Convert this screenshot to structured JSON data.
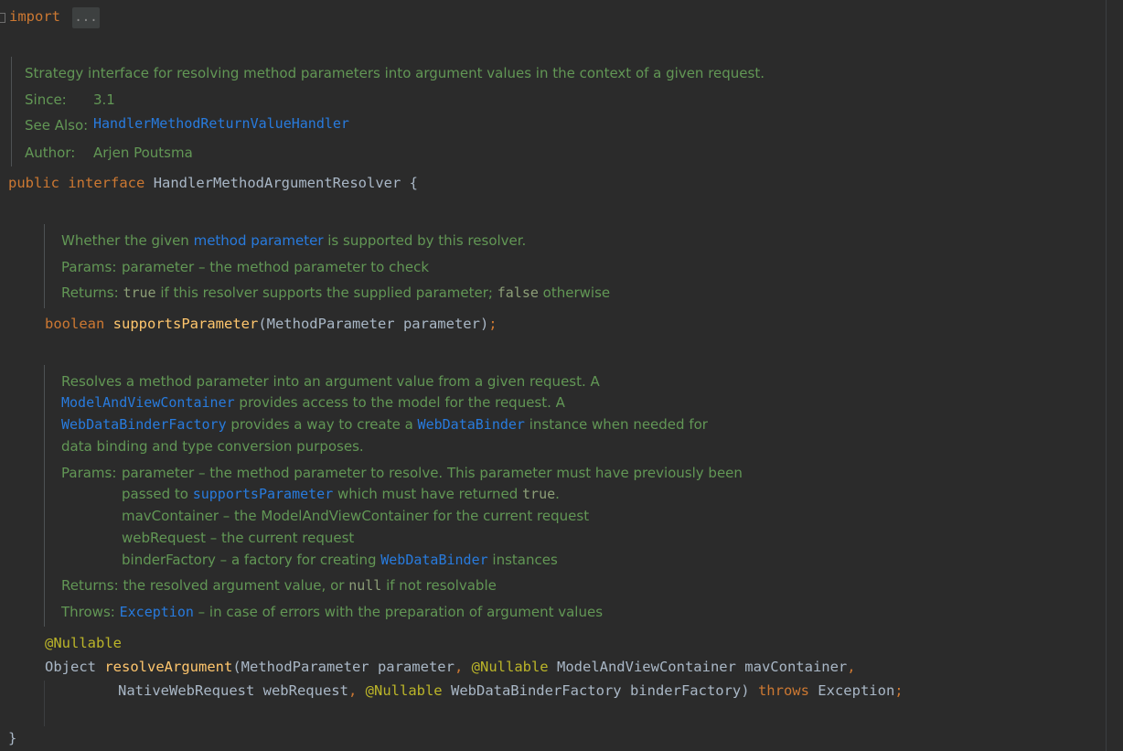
{
  "editor": {
    "import_keyword": "import",
    "import_folded": "...",
    "class_doc": {
      "description": "Strategy interface for resolving method parameters into argument values in the context of a given request.",
      "since_label": "Since:",
      "since_value": "3.1",
      "see_also_label": "See Also:",
      "see_also_link": "HandlerMethodReturnValueHandler",
      "author_label": "Author:",
      "author_value": "Arjen Poutsma"
    },
    "decl": {
      "public": "public",
      "interface": "interface",
      "name": "HandlerMethodArgumentResolver",
      "open_brace": "{",
      "close_brace": "}"
    },
    "method1_doc": {
      "desc_pre": "Whether the given ",
      "desc_link1": "method",
      "desc_space": " ",
      "desc_link2": "parameter",
      "desc_post": " is supported by this resolver.",
      "params_label": "Params:",
      "params_text": "parameter – the method parameter to check",
      "returns_label": "Returns:",
      "returns_true": "true",
      "returns_mid": " if this resolver supports the supplied parameter; ",
      "returns_false": "false",
      "returns_end": " otherwise"
    },
    "method1": {
      "return_type": "boolean",
      "name": "supportsParameter",
      "params": "(MethodParameter parameter)",
      "semicolon": ";"
    },
    "method2_doc": {
      "line1": "Resolves a method parameter into an argument value from a given request. A",
      "line2_link": "ModelAndViewContainer",
      "line2_text": " provides access to the model for the request. A",
      "line3_link": "WebDataBinderFactory",
      "line3_text_a": " provides a way to create a ",
      "line3_link2": "WebDataBinder",
      "line3_text_b": " instance when needed for",
      "line4": "data binding and type conversion purposes.",
      "params_label": "Params:",
      "p1": "parameter – the method parameter to resolve. This parameter must have previously been",
      "p2_pre": "passed to ",
      "p2_link": "supportsParameter",
      "p2_mid": " which must have returned ",
      "p2_code": "true",
      "p2_end": ".",
      "p3": "mavContainer – the ModelAndViewContainer for the current request",
      "p4": "webRequest – the current request",
      "p5_pre": "binderFactory – a factory for creating ",
      "p5_link": "WebDataBinder",
      "p5_end": " instances",
      "returns_label": "Returns:",
      "returns_pre": "the resolved argument value, or ",
      "returns_code": "null",
      "returns_end": " if not resolvable",
      "throws_label": "Throws:",
      "throws_link": "Exception",
      "throws_text": " – in case of errors with the preparation of argument values"
    },
    "method2": {
      "annotation": "@Nullable",
      "return_type": "Object",
      "name": "resolveArgument",
      "l1_a": "(MethodParameter parameter",
      "comma": ",",
      "ann_inline": "@Nullable",
      "l1_b": " ModelAndViewContainer mavContainer",
      "l2_a": "NativeWebRequest webRequest",
      "l2_b": " WebDataBinderFactory binderFactory)",
      "throws": "throws",
      "exception": " Exception",
      "semicolon": ";"
    }
  },
  "colors": {
    "background": "#2b2b2b",
    "keyword": "#cc7832",
    "function": "#ffc66d",
    "annotation": "#bbb529",
    "doc_text": "#629755",
    "doc_link": "#287bde",
    "plain": "#a9b7c6"
  }
}
